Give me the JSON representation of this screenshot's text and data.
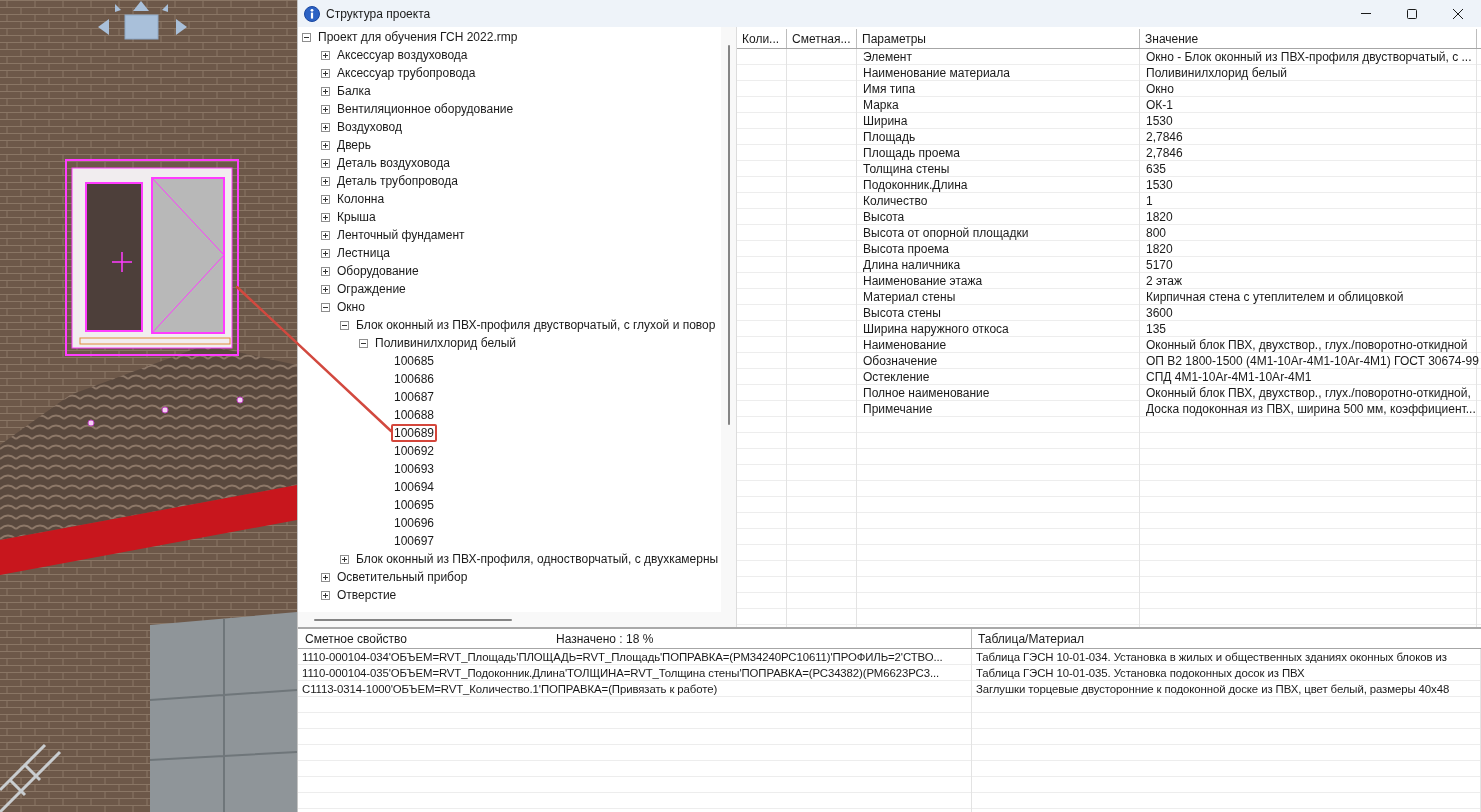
{
  "window": {
    "title": "Структура проекта"
  },
  "tree": [
    {
      "kind": "group",
      "label": "Проект для обучения ГСН 2022.rmp",
      "expanded": true,
      "children": [
        {
          "kind": "group",
          "label": "Аксессуар воздуховода",
          "expanded": false
        },
        {
          "kind": "group",
          "label": "Аксессуар трубопровода",
          "expanded": false
        },
        {
          "kind": "group",
          "label": "Балка",
          "expanded": false
        },
        {
          "kind": "group",
          "label": "Вентиляционное оборудование",
          "expanded": false
        },
        {
          "kind": "group",
          "label": "Воздуховод",
          "expanded": false
        },
        {
          "kind": "group",
          "label": "Дверь",
          "expanded": false
        },
        {
          "kind": "group",
          "label": "Деталь воздуховода",
          "expanded": false
        },
        {
          "kind": "group",
          "label": "Деталь трубопровода",
          "expanded": false
        },
        {
          "kind": "group",
          "label": "Колонна",
          "expanded": false
        },
        {
          "kind": "group",
          "label": "Крыша",
          "expanded": false
        },
        {
          "kind": "group",
          "label": "Ленточный фундамент",
          "expanded": false
        },
        {
          "kind": "group",
          "label": "Лестница",
          "expanded": false
        },
        {
          "kind": "group",
          "label": "Оборудование",
          "expanded": false
        },
        {
          "kind": "group",
          "label": "Ограждение",
          "expanded": false
        },
        {
          "kind": "group",
          "label": "Окно",
          "expanded": true,
          "children": [
            {
              "kind": "group",
              "label": "Блок оконный из ПВХ-профиля двустворчатый, с глухой и повор",
              "expanded": true,
              "children": [
                {
                  "kind": "group",
                  "label": "Поливинилхлорид белый",
                  "expanded": true,
                  "children": [
                    {
                      "kind": "leaf",
                      "label": "100685",
                      "highlighted": false
                    },
                    {
                      "kind": "leaf",
                      "label": "100686",
                      "highlighted": false
                    },
                    {
                      "kind": "leaf",
                      "label": "100687",
                      "highlighted": false
                    },
                    {
                      "kind": "leaf",
                      "label": "100688",
                      "highlighted": false
                    },
                    {
                      "kind": "leaf",
                      "label": "100689",
                      "highlighted": true
                    },
                    {
                      "kind": "leaf",
                      "label": "100692",
                      "highlighted": false
                    },
                    {
                      "kind": "leaf",
                      "label": "100693",
                      "highlighted": false
                    },
                    {
                      "kind": "leaf",
                      "label": "100694",
                      "highlighted": false
                    },
                    {
                      "kind": "leaf",
                      "label": "100695",
                      "highlighted": false
                    },
                    {
                      "kind": "leaf",
                      "label": "100696",
                      "highlighted": false
                    },
                    {
                      "kind": "leaf",
                      "label": "100697",
                      "highlighted": false
                    }
                  ]
                }
              ]
            },
            {
              "kind": "group",
              "label": "Блок оконный из ПВХ-профиля, одностворчатый, с двухкамерны",
              "expanded": false
            }
          ]
        },
        {
          "kind": "group",
          "label": "Осветительный прибор",
          "expanded": false
        },
        {
          "kind": "group",
          "label": "Отверстие",
          "expanded": false
        }
      ]
    }
  ],
  "properties_table": {
    "columns": [
      "Коли...",
      "Сметная...",
      "Параметры",
      "Значение"
    ],
    "rows": [
      {
        "parameter": "Элемент",
        "value": "Окно - Блок оконный из ПВХ-профиля двустворчатый, с ..."
      },
      {
        "parameter": "Наименование материала",
        "value": "Поливинилхлорид белый"
      },
      {
        "parameter": "Имя типа",
        "value": "Окно"
      },
      {
        "parameter": "Марка",
        "value": "ОК-1"
      },
      {
        "parameter": "Ширина",
        "value": "1530"
      },
      {
        "parameter": "Площадь",
        "value": "2,7846"
      },
      {
        "parameter": "Площадь проема",
        "value": "2,7846"
      },
      {
        "parameter": "Толщина стены",
        "value": "635"
      },
      {
        "parameter": "Подоконник.Длина",
        "value": "1530"
      },
      {
        "parameter": "Количество",
        "value": "1"
      },
      {
        "parameter": "Высота",
        "value": "1820"
      },
      {
        "parameter": "Высота от опорной площадки",
        "value": "800"
      },
      {
        "parameter": "Высота проема",
        "value": "1820"
      },
      {
        "parameter": "Длина наличника",
        "value": "5170"
      },
      {
        "parameter": "Наименование этажа",
        "value": "2 этаж"
      },
      {
        "parameter": "Материал стены",
        "value": "Кирпичная стена с утеплителем и облицовкой"
      },
      {
        "parameter": "Высота стены",
        "value": "3600"
      },
      {
        "parameter": "Ширина наружного откоса",
        "value": "135"
      },
      {
        "parameter": "Наименование",
        "value": "Оконный блок ПВХ, двухствор., глух./поворотно-откидной"
      },
      {
        "parameter": "Обозначение",
        "value": "ОП В2 1800-1500 (4М1-10Ar-4М1-10Ar-4М1) ГОСТ 30674-99"
      },
      {
        "parameter": "Остекление",
        "value": "СПД 4М1-10Ar-4М1-10Ar-4М1"
      },
      {
        "parameter": "Полное наименование",
        "value": "Оконный блок ПВХ, двухствор., глух./поворотно-откидной,"
      },
      {
        "parameter": "Примечание",
        "value": "Доска подоконная из ПВХ, ширина 500 мм, коэффициент..."
      }
    ]
  },
  "estimate_panel": {
    "columns": [
      "Сметное свойство",
      "Таблица/Материал"
    ],
    "assigned": "Назначено : 18 %",
    "rows": [
      {
        "property": "1110-000104-034'ОБЪЕМ=RVT_Площадь'ПЛОЩАДЬ=RVT_Площадь'ПОПРАВКА=(РМ34240РС10611)'ПРОФИЛЬ=2'СТВО...",
        "table_material": "Таблица ГЭСН 10-01-034. Установка в жилых и общественных зданиях оконных блоков из"
      },
      {
        "property": "1110-000104-035'ОБЪЕМ=RVT_Подоконник.Длина'ТОЛЩИНА=RVT_Толщина стены'ПОПРАВКА=(РС34382)(РМ6623РС3...",
        "table_material": "Таблица ГЭСН 10-01-035. Установка подоконных досок из ПВХ"
      },
      {
        "property": "С1113-0314-1000'ОБЪЕМ=RVT_Количество.1'ПОПРАВКА=(Привязать к работе)",
        "table_material": "Заглушки торцевые двусторонние к подоконной доске из ПВХ, цвет белый, размеры 40х48"
      }
    ]
  }
}
